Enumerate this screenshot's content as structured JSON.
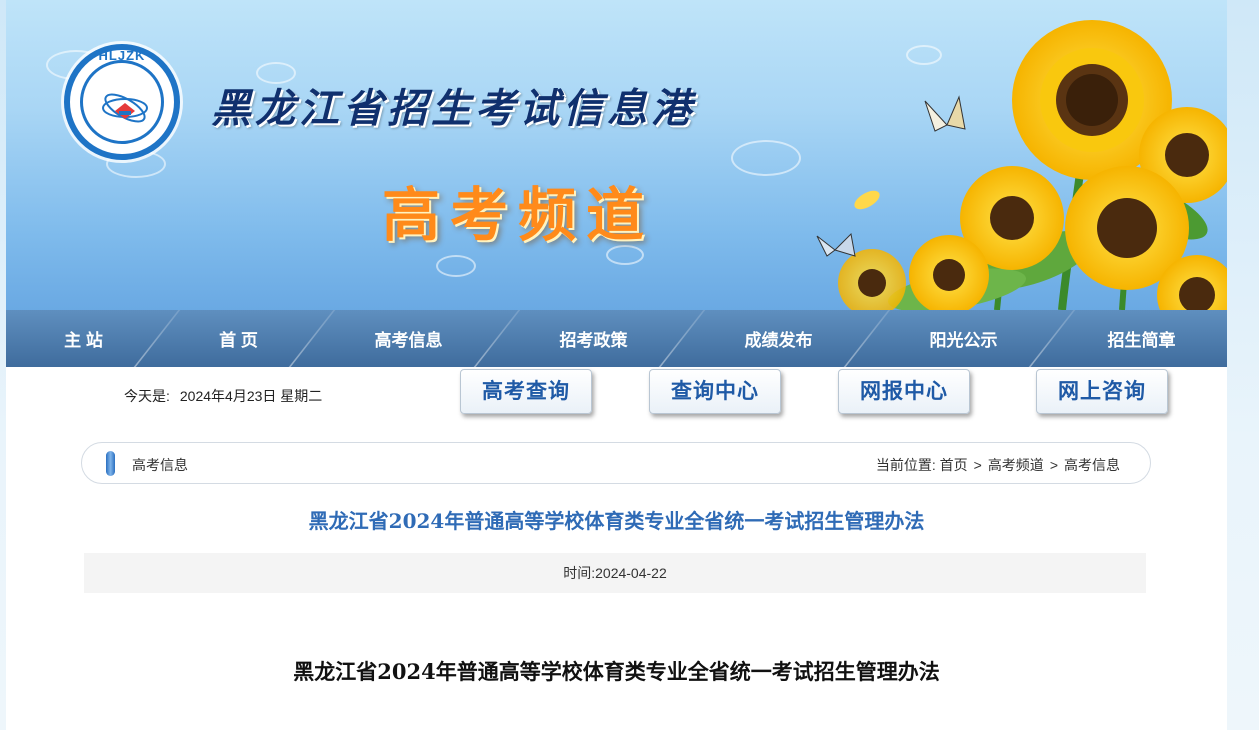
{
  "header": {
    "logo_text": "HLJZK",
    "logo_ring_text": "黑龙江招生考试信息港",
    "site_title": "黑龙江省招生考试信息港",
    "channel_title": "高考频道"
  },
  "nav": {
    "items": [
      {
        "label": "主 站"
      },
      {
        "label": "首 页"
      },
      {
        "label": "高考信息"
      },
      {
        "label": "招考政策"
      },
      {
        "label": "成绩发布"
      },
      {
        "label": "阳光公示"
      },
      {
        "label": "招生简章"
      }
    ]
  },
  "toolbar": {
    "today_label": "今天是:",
    "today_value": "2024年4月23日 星期二",
    "buttons": [
      {
        "label": "高考查询"
      },
      {
        "label": "查询中心"
      },
      {
        "label": "网报中心"
      },
      {
        "label": "网上咨询"
      }
    ]
  },
  "breadcrumb": {
    "section": "高考信息",
    "prefix": "当前位置:",
    "path": [
      "首页",
      "高考频道",
      "高考信息"
    ],
    "separator": ">"
  },
  "article": {
    "title": "黑龙江省2024年普通高等学校体育类专业全省统一考试招生管理办法",
    "time_label": "时间:",
    "time_value": "2024-04-22",
    "body_title": "黑龙江省2024年普通高等学校体育类专业全省统一考试招生管理办法"
  },
  "colors": {
    "nav_bg": "#4a78a8",
    "title_blue": "#2f6bb6",
    "channel_orange": "#ff8a1a",
    "logo_blue": "#1e74c6"
  }
}
